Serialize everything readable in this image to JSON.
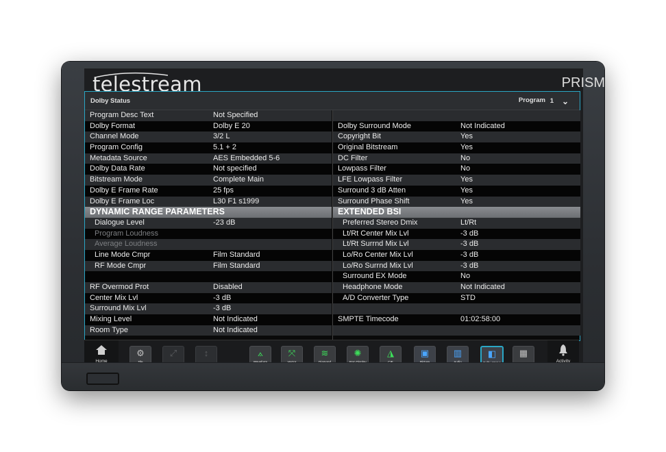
{
  "brand": {
    "logo": "telestream",
    "product": "PRISM"
  },
  "panel": {
    "title": "Dolby Status",
    "program_label": "Program",
    "program_value": "1"
  },
  "left_rows": [
    {
      "k": "Program Desc Text",
      "v": "Not Specified"
    },
    {
      "k": "Dolby Format",
      "v": "Dolby E 20"
    },
    {
      "k": "Channel Mode",
      "v": "3/2 L"
    },
    {
      "k": "Program Config",
      "v": "5.1 + 2"
    },
    {
      "k": "Metadata Source",
      "v": "AES Embedded 5-6"
    },
    {
      "k": "Dolby Data Rate",
      "v": "Not specified"
    },
    {
      "k": "Bitstream Mode",
      "v": "Complete Main"
    },
    {
      "k": "Dolby E Frame Rate",
      "v": "25 fps"
    },
    {
      "k": "Dolby E Frame Loc",
      "v": "L30 F1 s1999"
    },
    {
      "k": "DYNAMIC RANGE PARAMETERS",
      "v": ""
    },
    {
      "k": "Dialogue Level",
      "v": "-23 dB"
    },
    {
      "k": "Program Loudness",
      "v": ""
    },
    {
      "k": "Average Loudness",
      "v": ""
    },
    {
      "k": "Line Mode Cmpr",
      "v": "Film Standard"
    },
    {
      "k": "RF Mode Cmpr",
      "v": "Film Standard"
    },
    {
      "k": "",
      "v": ""
    },
    {
      "k": "RF Overmod Prot",
      "v": "Disabled"
    },
    {
      "k": "Center Mix Lvl",
      "v": "-3 dB"
    },
    {
      "k": "Surround Mix Lvl",
      "v": "-3 dB"
    },
    {
      "k": "Mixing Level",
      "v": "Not Indicated"
    },
    {
      "k": "Room Type",
      "v": "Not Indicated"
    }
  ],
  "right_rows": [
    {
      "k": "",
      "v": ""
    },
    {
      "k": "Dolby Surround Mode",
      "v": "Not Indicated"
    },
    {
      "k": "Copyright Bit",
      "v": "Yes"
    },
    {
      "k": "Original Bitstream",
      "v": "Yes"
    },
    {
      "k": "DC Filter",
      "v": "No"
    },
    {
      "k": "Lowpass Filter",
      "v": "No"
    },
    {
      "k": "LFE Lowpass Filter",
      "v": "Yes"
    },
    {
      "k": "Surround 3 dB Atten",
      "v": "Yes"
    },
    {
      "k": "Surround Phase Shift",
      "v": "Yes"
    },
    {
      "k": "EXTENDED BSI",
      "v": ""
    },
    {
      "k": "Preferred Stereo Dmix",
      "v": "Lt/Rt"
    },
    {
      "k": "Lt/Rt Center Mix Lvl",
      "v": "-3 dB"
    },
    {
      "k": "Lt/Rt Surrnd Mix Lvl",
      "v": "-3 dB"
    },
    {
      "k": "Lo/Ro Center Mix Lvl",
      "v": "-3 dB"
    },
    {
      "k": "Lo/Ro Surrnd Mix Lvl",
      "v": "-3 dB"
    },
    {
      "k": "Surround EX Mode",
      "v": "No"
    },
    {
      "k": "Headphone Mode",
      "v": "Not Indicated"
    },
    {
      "k": "A/D Converter Type",
      "v": "STD"
    },
    {
      "k": "",
      "v": ""
    },
    {
      "k": "SMPTE Timecode",
      "v": "01:02:58:00"
    },
    {
      "k": "",
      "v": ""
    }
  ],
  "dock": {
    "home": "Home",
    "activity": "Activity",
    "buttons": [
      {
        "label": "Tile",
        "icon": "gear-icon"
      },
      {
        "label": "",
        "icon": "expand-icon"
      },
      {
        "label": "",
        "icon": "updown-icon"
      },
      {
        "label": "Waveform",
        "icon": "waveform-icon"
      },
      {
        "label": "Vector",
        "icon": "vector-icon"
      },
      {
        "label": "Diamond",
        "icon": "diamond-icon"
      },
      {
        "label": "Stop Display",
        "icon": "stop-display-icon"
      },
      {
        "label": "CIE",
        "icon": "cie-icon"
      },
      {
        "label": "Picture",
        "icon": "picture-icon"
      },
      {
        "label": "Audio",
        "icon": "audio-icon"
      },
      {
        "label": "Dolby Status",
        "icon": "dolby-icon"
      },
      {
        "label": "",
        "icon": "grid-icon"
      }
    ]
  },
  "colors": {
    "accent": "#2aa7c6",
    "scope_green": "#3ddc5a",
    "audio_blue": "#4aa6ff"
  }
}
